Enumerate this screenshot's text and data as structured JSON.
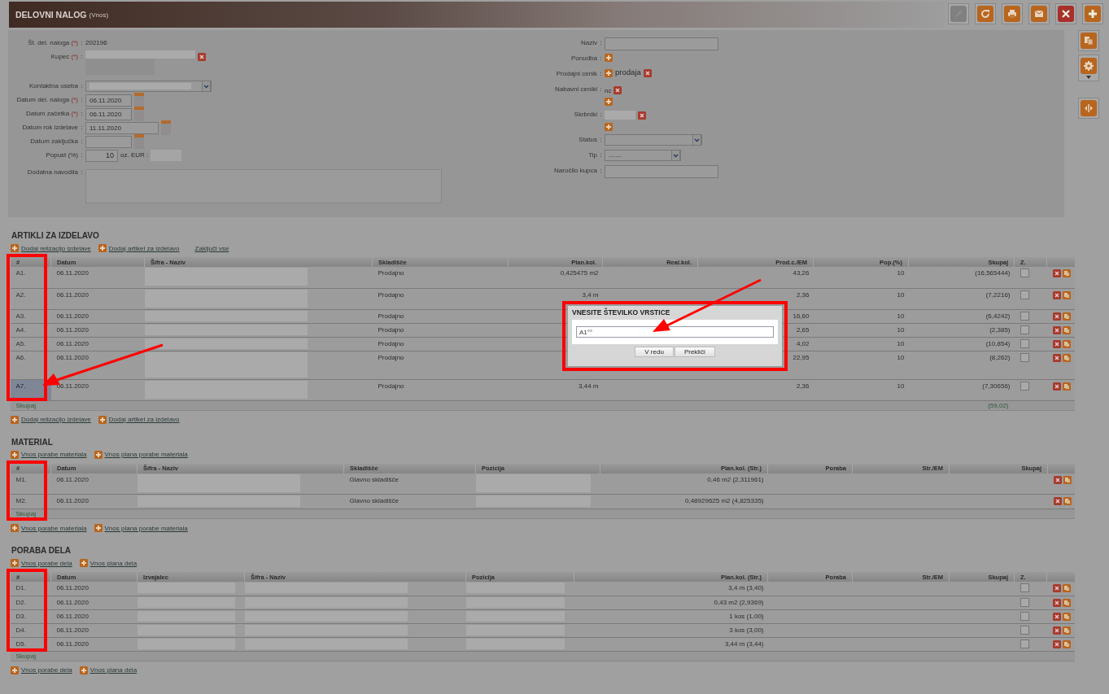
{
  "header": {
    "title": "DELOVNI NALOG",
    "subtitle": "(Vnos)"
  },
  "toolbar": [
    {
      "kind": "edit",
      "disabled": true
    },
    {
      "kind": "refresh",
      "disabled": false
    },
    {
      "kind": "print",
      "disabled": false
    },
    {
      "kind": "mail",
      "disabled": false
    },
    {
      "kind": "close",
      "disabled": false
    },
    {
      "kind": "add",
      "disabled": false
    }
  ],
  "side_toolbar": [
    {
      "kind": "copy"
    },
    {
      "kind": "settings"
    },
    {
      "kind": "split"
    }
  ],
  "separator": ":",
  "required_mark": "(*)",
  "left_fields": [
    {
      "label": "Št. del. naloga",
      "required": true,
      "kind": "text",
      "value": "202196"
    },
    {
      "label": "Kupec",
      "required": true,
      "kind": "redacted"
    },
    {
      "label": "Kontaktna oseba",
      "required": false,
      "kind": "select"
    },
    {
      "label": "Datum del. naloga",
      "required": true,
      "kind": "date",
      "value": "06.11.2020"
    },
    {
      "label": "Datum začetka",
      "required": true,
      "kind": "date",
      "value": "06.11.2020"
    },
    {
      "label": "Datum rok izdelave",
      "required": false,
      "kind": "date_wide",
      "value": "11.11.2020"
    },
    {
      "label": "Datum zaključka",
      "required": false,
      "kind": "date"
    },
    {
      "label": "Popust (%)",
      "required": false,
      "kind": "discount",
      "value": "10",
      "extra_label": "oz. EUR :"
    },
    {
      "label": "Dodatna navodila",
      "required": false,
      "kind": "textarea"
    }
  ],
  "right_fields": [
    {
      "label": "Naziv",
      "kind": "field"
    },
    {
      "label": "Ponudba",
      "kind": "add"
    },
    {
      "label": "Prodajni cenik",
      "kind": "price_list",
      "value": "prodaja"
    },
    {
      "label": "Nabavni ceniki",
      "kind": "list",
      "value": "nc"
    },
    {
      "label": "Skrbniki",
      "kind": "redacted_list"
    },
    {
      "label": "Status",
      "kind": "select"
    },
    {
      "label": "Tip",
      "kind": "select",
      "placeholder": "------"
    },
    {
      "label": "Naročilo kupca",
      "kind": "field"
    }
  ],
  "sections": [
    {
      "title": "ARTIKLI ZA IZDELAVO",
      "links": [
        {
          "kind": "add",
          "label": "Dodaj relizacijo izdelave"
        },
        {
          "kind": "add",
          "label": "Dodaj artikel za izdelavo"
        },
        {
          "kind": "plain",
          "label": "Zaključi vse"
        }
      ],
      "columns": [
        {
          "label": "#",
          "kind": "text"
        },
        {
          "label": "Datum",
          "kind": "text"
        },
        {
          "label": "Šifra - Naziv",
          "kind": "redacted"
        },
        {
          "label": "Skladišče",
          "kind": "text"
        },
        {
          "label": "Plan.kol.",
          "kind": "number"
        },
        {
          "label": "Real.kol.",
          "kind": "number"
        },
        {
          "label": "Prod.c./EM",
          "kind": "number"
        },
        {
          "label": "Pop.(%)",
          "kind": "number"
        },
        {
          "label": "Skupaj",
          "kind": "number"
        },
        {
          "label": "Z.",
          "kind": "check"
        },
        {
          "kind": "actions"
        }
      ],
      "rows": [
        {
          "num": "A1.",
          "date": "06.11.2020",
          "store": "Prodajno",
          "plan": "0,425475 m2",
          "price": "43,26",
          "disc": "10",
          "total": "(16,565444)",
          "closed": false,
          "selected": false
        },
        {
          "num": "A2.",
          "date": "06.11.2020",
          "store": "Prodajno",
          "plan": "3,4 m",
          "price": "2,36",
          "disc": "10",
          "total": "(7,2216)",
          "closed": false,
          "selected": false
        },
        {
          "num": "A3.",
          "date": "06.11.2020",
          "store": "Prodajno",
          "price": "16,60",
          "disc": "10",
          "total": "(6,4242)",
          "closed": false,
          "selected": false
        },
        {
          "num": "A4.",
          "date": "06.11.2020",
          "store": "Prodajno",
          "price": "2,65",
          "disc": "10",
          "total": "(2,385)",
          "closed": false,
          "selected": false
        },
        {
          "num": "A5.",
          "date": "06.11.2020",
          "store": "Prodajno",
          "price": "4,02",
          "disc": "10",
          "total": "(10,854)",
          "closed": false,
          "selected": false
        },
        {
          "num": "A6.",
          "date": "06.11.2020",
          "store": "Prodajno",
          "price": "22,95",
          "disc": "10",
          "total": "(8,262)",
          "closed": false,
          "selected": false
        },
        {
          "num": "A7.",
          "date": "06.11.2020",
          "store": "Prodajno",
          "plan": "3,44 m",
          "price": "2,36",
          "disc": "10",
          "total": "(7,30656)",
          "closed": false,
          "selected": true
        }
      ],
      "total": {
        "label": "Skupaj",
        "value": "(59,02)"
      },
      "bottom_links": [
        {
          "kind": "add",
          "label": "Dodaj relizacijo izdelave"
        },
        {
          "kind": "add",
          "label": "Dodaj artikel za izdelavo"
        }
      ]
    },
    {
      "title": "MATERIAL",
      "links": [
        {
          "kind": "add",
          "label": "Vnos porabe materiala"
        },
        {
          "kind": "add",
          "label": "Vnos plana porabe materiala"
        }
      ],
      "columns": [
        {
          "label": "#",
          "kind": "text"
        },
        {
          "label": "Datum",
          "kind": "text"
        },
        {
          "label": "Šifra - Naziv",
          "kind": "redacted"
        },
        {
          "label": "Skladišče",
          "kind": "text"
        },
        {
          "label": "Pozicija",
          "kind": "redacted"
        },
        {
          "label": "Plan.kol. (Str.)",
          "kind": "number"
        },
        {
          "label": "Poraba",
          "kind": "number"
        },
        {
          "label": "Str./EM",
          "kind": "number"
        },
        {
          "label": "Skupaj",
          "kind": "number"
        },
        {
          "kind": "actions"
        }
      ],
      "rows": [
        {
          "num": "M1.",
          "date": "06.11.2020",
          "store": "Glavno skladišče",
          "plan": "0,46 m2 (2,311961)",
          "selected": false
        },
        {
          "num": "M2.",
          "date": "06.11.2020",
          "store": "Glavno skladišče",
          "plan": "0,48929625 m2 (4,825335)",
          "selected": false
        }
      ],
      "total": {
        "label": "Skupaj"
      },
      "bottom_links": [
        {
          "kind": "add",
          "label": "Vnos porabe materiala"
        },
        {
          "kind": "add",
          "label": "Vnos plana porabe materiala"
        }
      ]
    },
    {
      "title": "PORABA DELA",
      "links": [
        {
          "kind": "add",
          "label": "Vnos porabe dela"
        },
        {
          "kind": "add",
          "label": "Vnos plana dela"
        }
      ],
      "columns": [
        {
          "label": "#",
          "kind": "text"
        },
        {
          "label": "Datum",
          "kind": "text"
        },
        {
          "label": "Izvajalec",
          "kind": "redacted"
        },
        {
          "label": "Šifra - Naziv",
          "kind": "redacted"
        },
        {
          "label": "Pozicija",
          "kind": "redacted"
        },
        {
          "label": "Plan.kol. (Str.)",
          "kind": "number"
        },
        {
          "label": "Poraba",
          "kind": "number"
        },
        {
          "label": "Str./EM",
          "kind": "number"
        },
        {
          "label": "Skupaj",
          "kind": "number"
        },
        {
          "label": "Z.",
          "kind": "check"
        },
        {
          "kind": "actions"
        }
      ],
      "rows": [
        {
          "num": "D1.",
          "date": "06.11.2020",
          "plan": "3,4 m (3,40)",
          "closed": false,
          "selected": false
        },
        {
          "num": "D2.",
          "date": "06.11.2020",
          "plan": "0,43 m2 (2,9369)",
          "closed": false,
          "selected": false
        },
        {
          "num": "D3.",
          "date": "06.11.2020",
          "plan": "1 kos (1,00)",
          "closed": false,
          "selected": false
        },
        {
          "num": "D4.",
          "date": "06.11.2020",
          "plan": "3 kos (3,00)",
          "closed": false,
          "selected": false
        },
        {
          "num": "D5.",
          "date": "06.11.2020",
          "plan": "3,44 m (3,44)",
          "closed": false,
          "selected": false
        }
      ],
      "total": {
        "label": "Skupaj"
      },
      "bottom_links": [
        {
          "kind": "add",
          "label": "Vnos porabe dela"
        },
        {
          "kind": "add",
          "label": "Vnos plana dela"
        }
      ]
    }
  ],
  "dialog": {
    "title": "VNESITE ŠTEVILKO VRSTICE",
    "value": "A1°°",
    "buttons": [
      "V redu",
      "Prekliči"
    ]
  }
}
